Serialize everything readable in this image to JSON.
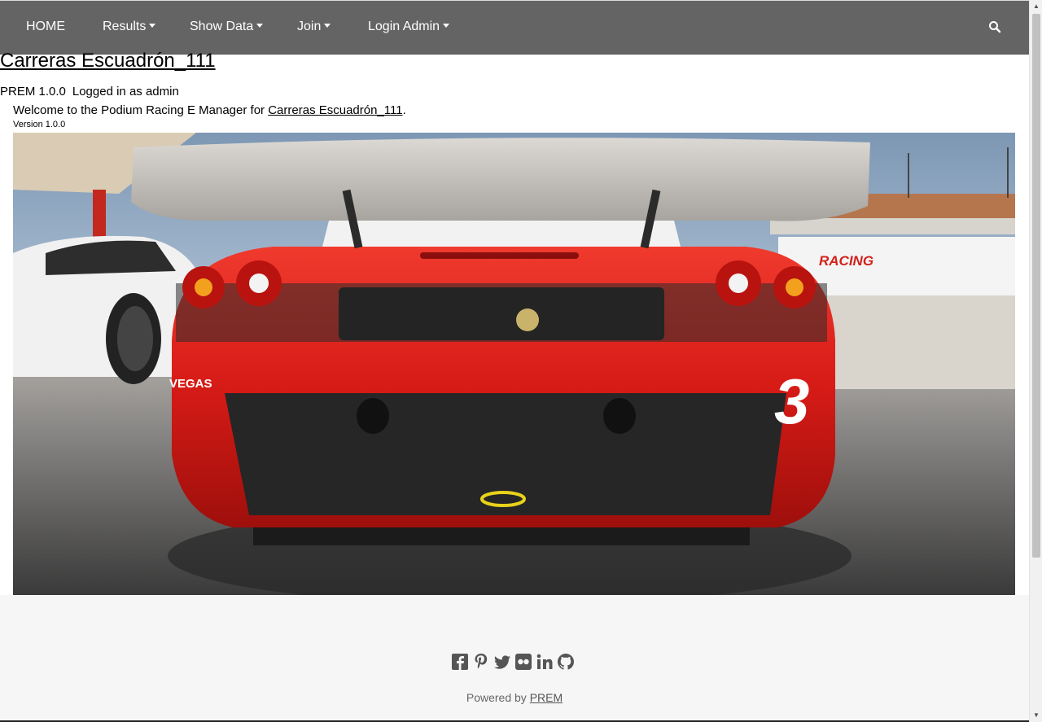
{
  "nav": {
    "home": "HOME",
    "results": "Results",
    "show_data": "Show Data",
    "join": "Join",
    "login_admin": "Login Admin",
    "search_icon": "search-icon"
  },
  "header": {
    "site_title": "Carreras Escuadrón_111",
    "app_version_label": "PREM 1.0.0",
    "logged_in_text": "Logged in as admin",
    "welcome_prefix": "Welcome to the Podium Racing E Manager for ",
    "welcome_link": "Carreras Escuadrón_111",
    "welcome_suffix": ".",
    "version_text": "Version 1.0.0"
  },
  "hero": {
    "car_number": "3",
    "sponsor_text": "RACING",
    "decal_text": "VEGAS"
  },
  "footer": {
    "social_icons": [
      "facebook-icon",
      "pinterest-icon",
      "twitter-icon",
      "flickr-icon",
      "linkedin-icon",
      "github-icon"
    ],
    "powered_prefix": "Powered by ",
    "powered_link": "PREM"
  },
  "colors": {
    "navbar_bg": "#646464",
    "footer_bg": "#f6f6f6",
    "car_red": "#d81e1e"
  }
}
